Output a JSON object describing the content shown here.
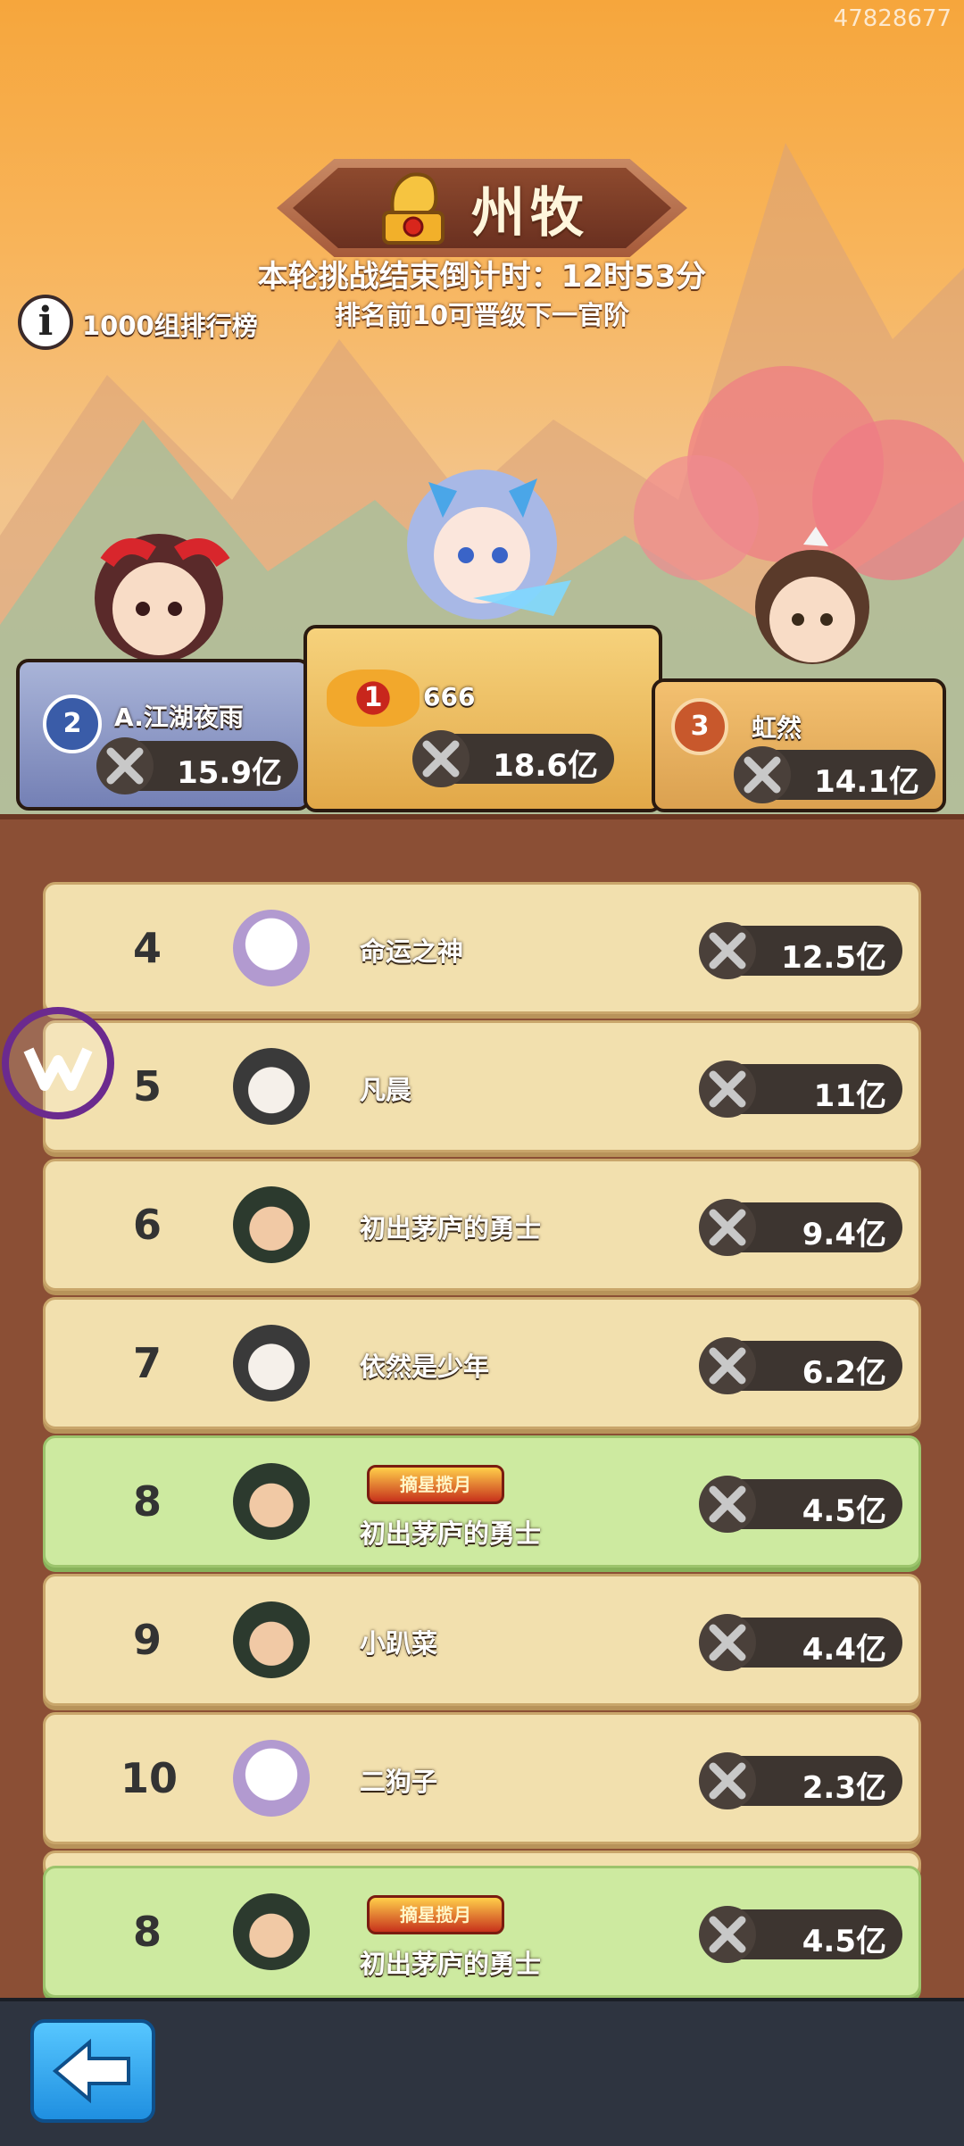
{
  "header": {
    "uid": "47828677",
    "rank_title": "州牧",
    "countdown": "本轮挑战结束倒计时：12时53分",
    "promotion_note": "排名前10可晋级下一官阶",
    "leaderboard_label": "1000组排行榜"
  },
  "podium": [
    {
      "rank": "1",
      "name": "666",
      "power": "18.6亿"
    },
    {
      "rank": "2",
      "name": "A.江湖夜雨",
      "power": "15.9亿"
    },
    {
      "rank": "3",
      "name": "虹然",
      "power": "14.1亿"
    }
  ],
  "ranking": [
    {
      "rank": "4",
      "name": "命运之神",
      "power": "12.5亿",
      "avatar": "rabbit-avatar"
    },
    {
      "rank": "5",
      "name": "凡晨",
      "power": "11亿",
      "avatar": "panda-avatar"
    },
    {
      "rank": "6",
      "name": "初出茅庐的勇士",
      "power": "9.4亿",
      "avatar": "warrior-avatar"
    },
    {
      "rank": "7",
      "name": "依然是少年",
      "power": "6.2亿",
      "avatar": "panda-avatar"
    },
    {
      "rank": "8",
      "name": "初出茅庐的勇士",
      "power": "4.5亿",
      "avatar": "warrior-avatar",
      "badge": "摘星揽月"
    },
    {
      "rank": "9",
      "name": "小趴菜",
      "power": "4.4亿",
      "avatar": "warrior-avatar"
    },
    {
      "rank": "10",
      "name": "二狗子",
      "power": "2.3亿",
      "avatar": "rabbit-avatar"
    }
  ],
  "my_rank": {
    "rank": "8",
    "name": "初出茅庐的勇士",
    "power": "4.5亿",
    "badge": "摘星揽月"
  },
  "colors": {
    "row": "#f2e0ae",
    "my_row": "#cdeaa0",
    "board": "#8b4f35",
    "back_button": "#2aa0ee"
  }
}
